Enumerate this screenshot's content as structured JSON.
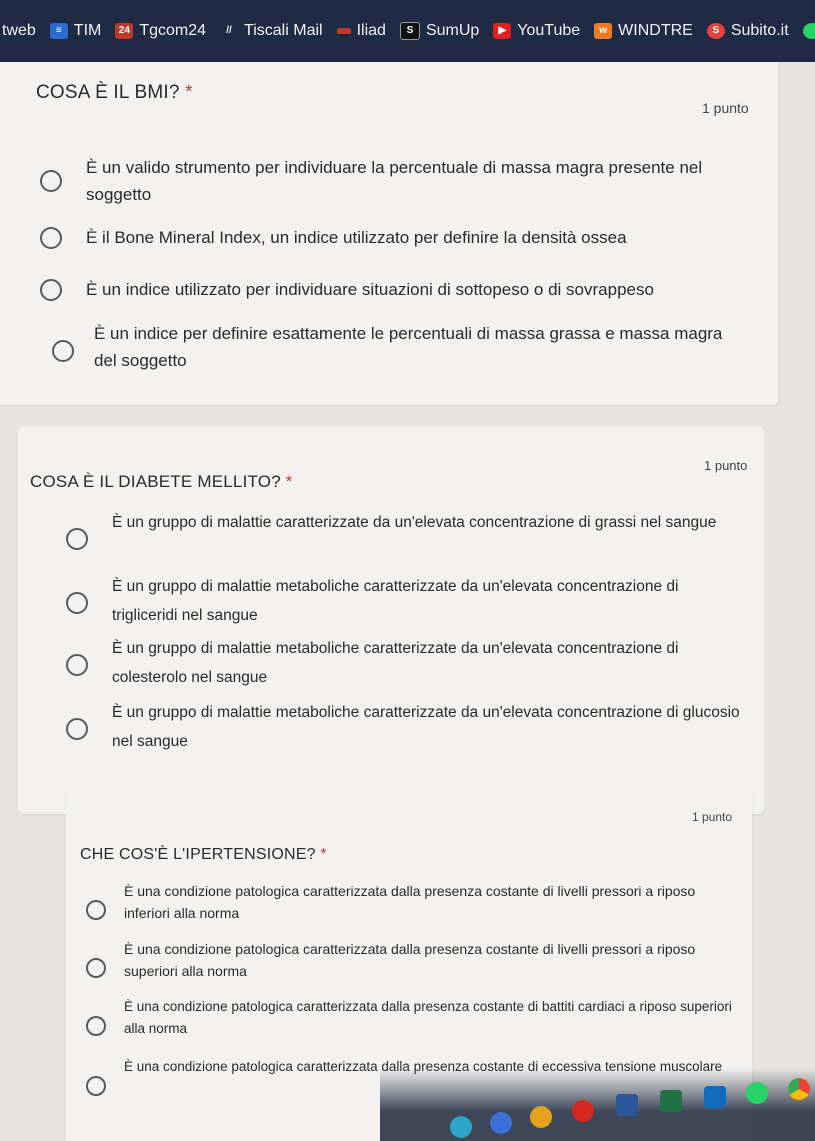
{
  "bookmarks": [
    {
      "label": "tweb",
      "icon": "none",
      "color": "#1f2a44"
    },
    {
      "label": "TIM",
      "icon": "tim-icon",
      "color": "#2b6cd4"
    },
    {
      "label": "Tgcom24",
      "icon": "tgcom24-icon",
      "color": "#c0392b",
      "icon_text": "24"
    },
    {
      "label": "Tiscali Mail",
      "icon": "tiscali-icon",
      "color": "#e8e8e8",
      "icon_text": "//"
    },
    {
      "label": "Iliad",
      "icon": "iliad-icon",
      "color": "#c0392b"
    },
    {
      "label": "SumUp",
      "icon": "sumup-icon",
      "color": "#111111"
    },
    {
      "label": "YouTube",
      "icon": "youtube-icon",
      "color": "#e02020"
    },
    {
      "label": "WINDTRE",
      "icon": "windtre-icon",
      "color": "#f07b20"
    },
    {
      "label": "Subito.it",
      "icon": "subito-icon",
      "color": "#e8423f"
    }
  ],
  "questions": [
    {
      "title": "COSA È IL BMI?",
      "required": "*",
      "points": "1 punto",
      "options": [
        "È un valido strumento per individuare la percentuale di massa magra presente nel soggetto",
        "È il Bone Mineral Index, un indice utilizzato per definire la densità ossea",
        "È un indice utilizzato per individuare situazioni di sottopeso o di sovrappeso",
        "È un indice per definire esattamente le percentuali di massa grassa e massa magra del soggetto"
      ]
    },
    {
      "title": "COSA È IL DIABETE MELLITO?",
      "required": "*",
      "points": "1 punto",
      "options": [
        "È un gruppo di malattie caratterizzate da un'elevata concentrazione di grassi nel sangue",
        "È un gruppo di malattie metaboliche caratterizzate da un'elevata concentrazione di trigliceridi nel sangue",
        "È un gruppo di malattie metaboliche caratterizzate da un'elevata concentrazione di colesterolo nel sangue",
        "È un gruppo di malattie metaboliche caratterizzate da un'elevata concentrazione di glucosio nel sangue"
      ]
    },
    {
      "title": "CHE COS'È L'IPERTENSIONE?",
      "required": "*",
      "points": "1 punto",
      "options": [
        "È una condizione patologica caratterizzata dalla presenza costante di livelli pressori a riposo inferiori alla norma",
        "È una condizione patologica caratterizzata dalla presenza costante di livelli pressori a riposo superiori alla norma",
        "È una condizione patologica caratterizzata dalla presenza costante di battiti cardiaci a riposo superiori alla norma",
        "È una condizione patologica caratterizzata dalla presenza costante di eccessiva tensione muscolare"
      ]
    }
  ]
}
